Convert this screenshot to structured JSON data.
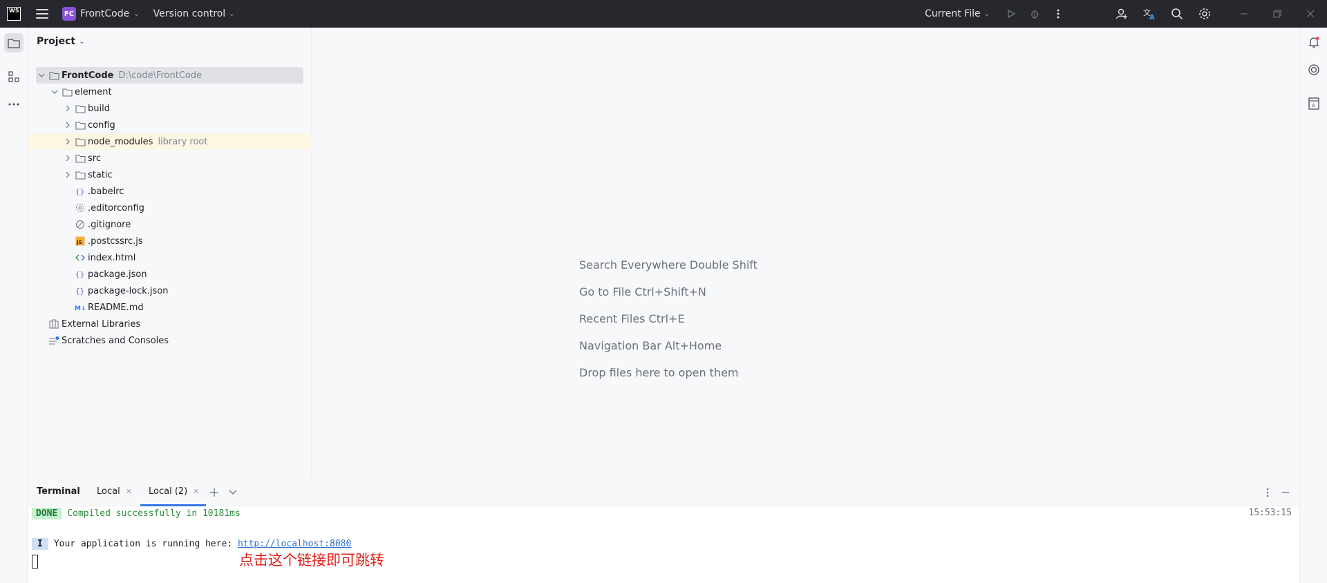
{
  "titlebar": {
    "logo": "WS",
    "project_badge": "FC",
    "project_name": "FrontCode",
    "vcs_label": "Version control",
    "run_config": "Current File",
    "colors": {
      "bg": "#27282e",
      "badge": "#8a54d9"
    }
  },
  "project_panel": {
    "title": "Project",
    "tree": [
      {
        "label": "FrontCode",
        "hint": "D:\\code\\FrontCode",
        "icon": "folder-icon",
        "expanded": true
      },
      {
        "label": "element",
        "icon": "folder-icon",
        "expanded": true
      },
      {
        "label": "build",
        "icon": "folder-icon"
      },
      {
        "label": "config",
        "icon": "folder-icon"
      },
      {
        "label": "node_modules",
        "hint": "library root",
        "icon": "folder-icon"
      },
      {
        "label": "src",
        "icon": "folder-icon"
      },
      {
        "label": "static",
        "icon": "folder-icon"
      },
      {
        "label": ".babelrc",
        "icon": "json-file-icon"
      },
      {
        "label": ".editorconfig",
        "icon": "gear-file-icon"
      },
      {
        "label": ".gitignore",
        "icon": "ignore-file-icon"
      },
      {
        "label": ".postcssrc.js",
        "icon": "js-file-icon"
      },
      {
        "label": "index.html",
        "icon": "html-file-icon"
      },
      {
        "label": "package.json",
        "icon": "json-file-icon"
      },
      {
        "label": "package-lock.json",
        "icon": "json-file-icon"
      },
      {
        "label": "README.md",
        "icon": "markdown-file-icon"
      },
      {
        "label": "External Libraries",
        "icon": "library-icon"
      },
      {
        "label": "Scratches and Consoles",
        "icon": "scratches-icon"
      }
    ]
  },
  "editor": {
    "hints": [
      "Search Everywhere Double Shift",
      "Go to File Ctrl+Shift+N",
      "Recent Files Ctrl+E",
      "Navigation Bar Alt+Home",
      "Drop files here to open them"
    ]
  },
  "terminal": {
    "title": "Terminal",
    "tabs": [
      "Local",
      "Local (2)"
    ],
    "active_tab": 1,
    "done_badge": "DONE",
    "compiled_text": "Compiled successfully in 10181ms",
    "timestamp": "15:53:15",
    "info_badge": "I",
    "running_text": "Your application is running here: ",
    "url": "http://localhost:8080",
    "annotation": "点击这个链接即可跳转"
  }
}
